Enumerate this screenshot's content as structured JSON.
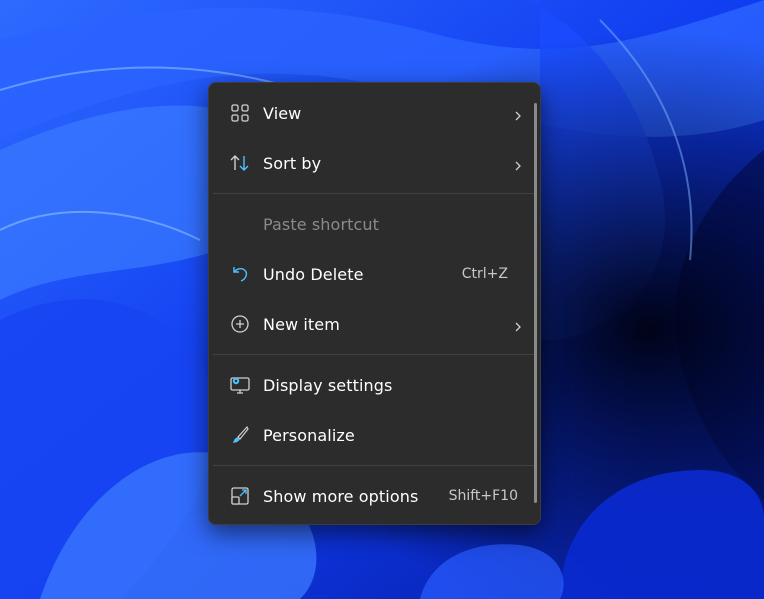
{
  "menu": {
    "items": [
      {
        "label": "View",
        "icon": "grid-icon",
        "has_submenu": true
      },
      {
        "label": "Sort by",
        "icon": "sort-icon",
        "has_submenu": true
      },
      {
        "label": "Paste shortcut",
        "icon": "",
        "disabled": true
      },
      {
        "label": "Undo Delete",
        "icon": "undo-icon",
        "shortcut": "Ctrl+Z"
      },
      {
        "label": "New item",
        "icon": "plus-circle-icon",
        "has_submenu": true
      },
      {
        "label": "Display settings",
        "icon": "display-settings-icon"
      },
      {
        "label": "Personalize",
        "icon": "brush-icon"
      },
      {
        "label": "Show more options",
        "icon": "open-external-icon",
        "shortcut": "Shift+F10"
      }
    ]
  },
  "colors": {
    "menu_bg": "#2c2c2c",
    "accent": "#4cc2ff",
    "text": "#ffffff",
    "disabled_text": "#8a8a8a",
    "wallpaper_blue": "#0a2bd8"
  }
}
